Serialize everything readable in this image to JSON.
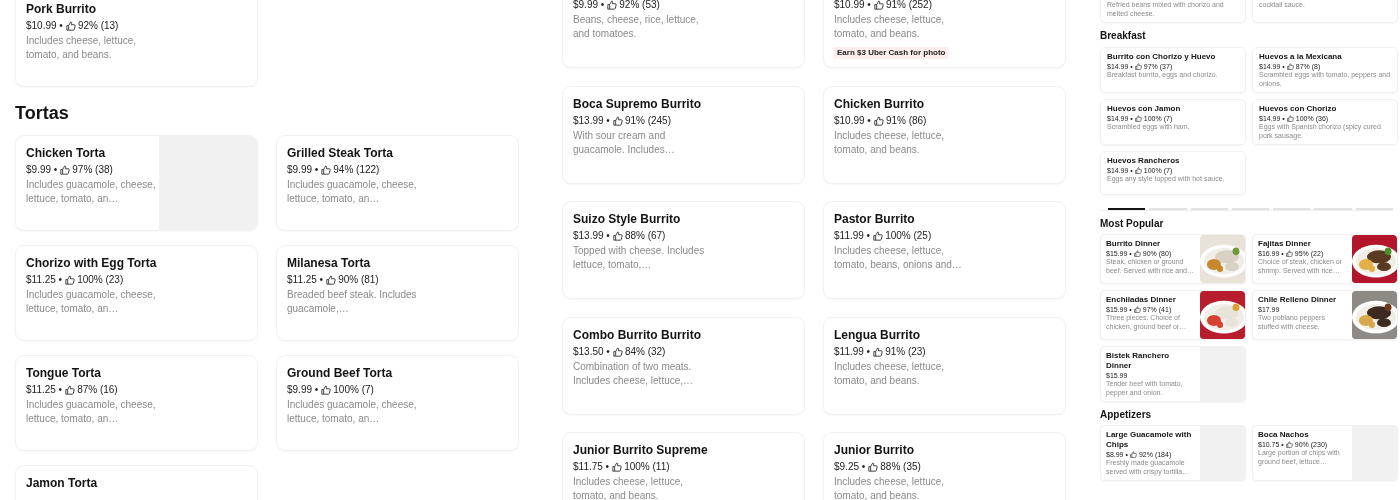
{
  "panels": [
    {
      "kind": "large",
      "blocks": [
        {
          "kind": "section",
          "items": [
            {
              "name": "Pork Burrito",
              "price": "$10.99 •",
              "rating": "92% (13)",
              "description": "Includes cheese, lettuce, tomato, and beans."
            }
          ]
        },
        {
          "kind": "section",
          "heading": "Tortas",
          "items": [
            {
              "name": "Chicken Torta",
              "price": "$9.99 •",
              "rating": "97% (38)",
              "description": "Includes guacamole, cheese, lettuce, tomato, an…",
              "media": {
                "kind": "placeholder"
              }
            },
            {
              "name": "Grilled Steak Torta",
              "price": "$9.99 •",
              "rating": "94% (122)",
              "description": "Includes guacamole, cheese, lettuce, tomato, an…"
            },
            {
              "name": "Chorizo with Egg Torta",
              "price": "$11.25 •",
              "rating": "100% (23)",
              "description": "Includes guacamole, cheese, lettuce, tomato, an…"
            },
            {
              "name": "Milanesa Torta",
              "price": "$11.25 •",
              "rating": "90% (81)",
              "description": "Breaded beef steak. Includes guacamole,…"
            },
            {
              "name": "Tongue Torta",
              "price": "$11.25 •",
              "rating": "87% (16)",
              "description": "Includes guacamole, cheese, lettuce, tomato, an…"
            },
            {
              "name": "Ground Beef Torta",
              "price": "$9.99 •",
              "rating": "100% (7)",
              "description": "Includes guacamole, cheese, lettuce, tomato, an…"
            },
            {
              "name": "Jamon Torta"
            }
          ]
        }
      ]
    },
    {
      "kind": "large",
      "blocks": [
        {
          "kind": "section",
          "items": [
            {
              "price": "$9.99 •",
              "rating": "92% (53)",
              "description": "Beans, cheese, rice, lettuce, and tomatoes."
            },
            {
              "price": "$10.99 •",
              "rating": "91% (252)",
              "description": "Includes cheese, lettuce, tomato, and beans.",
              "badge": "Earn $3 Uber Cash for photo"
            },
            {
              "name": "Boca Supremo Burrito",
              "price": "$13.99 •",
              "rating": "91% (245)",
              "description": "With sour cream and guacamole. Includes…"
            },
            {
              "name": "Chicken Burrito",
              "price": "$10.99 •",
              "rating": "91% (86)",
              "description": "Includes cheese, lettuce, tomato, and beans."
            },
            {
              "name": "Suizo Style Burrito",
              "price": "$13.99 •",
              "rating": "88% (67)",
              "description": "Topped with cheese. Includes lettuce, tomato,…"
            },
            {
              "name": "Pastor Burrito",
              "price": "$11.99 •",
              "rating": "100% (25)",
              "description": "Includes cheese, lettuce, tomato, beans, onions and…"
            },
            {
              "name": "Combo Burrito Burrito",
              "price": "$13.50 •",
              "rating": "84% (32)",
              "description": "Combination of two meats. Includes cheese, lettuce,…"
            },
            {
              "name": "Lengua Burrito",
              "price": "$11.99 •",
              "rating": "91% (23)",
              "description": "Includes cheese, lettuce, tomato, and beans."
            },
            {
              "name": "Junior Burrito Supreme",
              "price": "$11.75 •",
              "rating": "100% (11)",
              "description": "Includes cheese, lettuce, tomato, and beans."
            },
            {
              "name": "Junior Burrito",
              "price": "$9.25 •",
              "rating": "88% (35)",
              "description": "Includes cheese, lettuce, tomato, and beans."
            }
          ]
        }
      ]
    },
    {
      "kind": "small",
      "blocks": [
        {
          "kind": "section",
          "items": [
            {
              "description": "Refried beans mixed with chorizo and melted cheese."
            },
            {
              "description": "cocktail sauce."
            }
          ]
        },
        {
          "kind": "section",
          "heading": "Breakfast",
          "items": [
            {
              "name": "Burrito con Chorizo y Huevo",
              "price": "$14.99 •",
              "rating": "97% (37)",
              "description": "Breakfast burrito, eggs and chorizo."
            },
            {
              "name": "Huevos a la Mexicana",
              "price": "$14.99 •",
              "rating": "87% (8)",
              "description": "Scrambled eggs with tomato, peppers and onions."
            },
            {
              "name": "Huevos con Jamon",
              "price": "$14.99 •",
              "rating": "100% (7)",
              "description": "Scrambled eggs with ham."
            },
            {
              "name": "Huevos con Chorizo",
              "price": "$14.99 •",
              "rating": "100% (36)",
              "description": "Eggs with Spanish chorizo (spicy cured pork sausage."
            },
            {
              "name": "Huevos Rancheros",
              "price": "$14.99 •",
              "rating": "100% (7)",
              "description": "Eggs any style topped with hot sauce."
            }
          ]
        },
        {
          "kind": "tabs",
          "tabs": [
            {
              "selected": true
            },
            {
              "selected": false
            },
            {
              "selected": false
            },
            {
              "selected": false
            },
            {
              "selected": false
            },
            {
              "selected": false
            },
            {
              "selected": false
            }
          ]
        },
        {
          "kind": "mini",
          "heading": "Most Popular",
          "items": [
            {
              "name": "Burrito Dinner",
              "price": "$15.99 •",
              "rating": "90% (80)",
              "description": "Steak, chicken or ground beef. Served with rice and…"
            },
            {
              "name": "Fajitas Dinner",
              "price": "$16.99 •",
              "rating": "95% (22)",
              "description": "Choice of steak, chicken or shrimp. Served with rice…"
            },
            {
              "name": "Enchiladas Dinner",
              "price": "$15.99 •",
              "rating": "97% (41)",
              "description": "Three pieces. Choice of chicken, ground beef or…"
            },
            {
              "name": "Chile Relleno Dinner",
              "price": "$17.99",
              "description": "Two poblano peppers stuffed with cheese."
            },
            {
              "name": "Bistek Ranchero Dinner",
              "price": "$15.99",
              "description": "Tender beef with tomato, pepper and onion.",
              "media": {
                "kind": "placeholder"
              }
            }
          ]
        },
        {
          "kind": "mini",
          "heading": "Appetizers",
          "items": [
            {
              "name": "Large Guacamole with Chips",
              "price": "$8.99 •",
              "rating": "92% (184)",
              "description": "Freshly made guacamole served with crispy tortilla…",
              "media": {
                "kind": "placeholder"
              }
            },
            {
              "name": "Boca Nachos",
              "price": "$10.75 •",
              "rating": "90% (230)",
              "description": "Large portion of chips with ground beef, lettuce…",
              "media": {
                "kind": "placeholder"
              }
            }
          ]
        }
      ]
    }
  ]
}
